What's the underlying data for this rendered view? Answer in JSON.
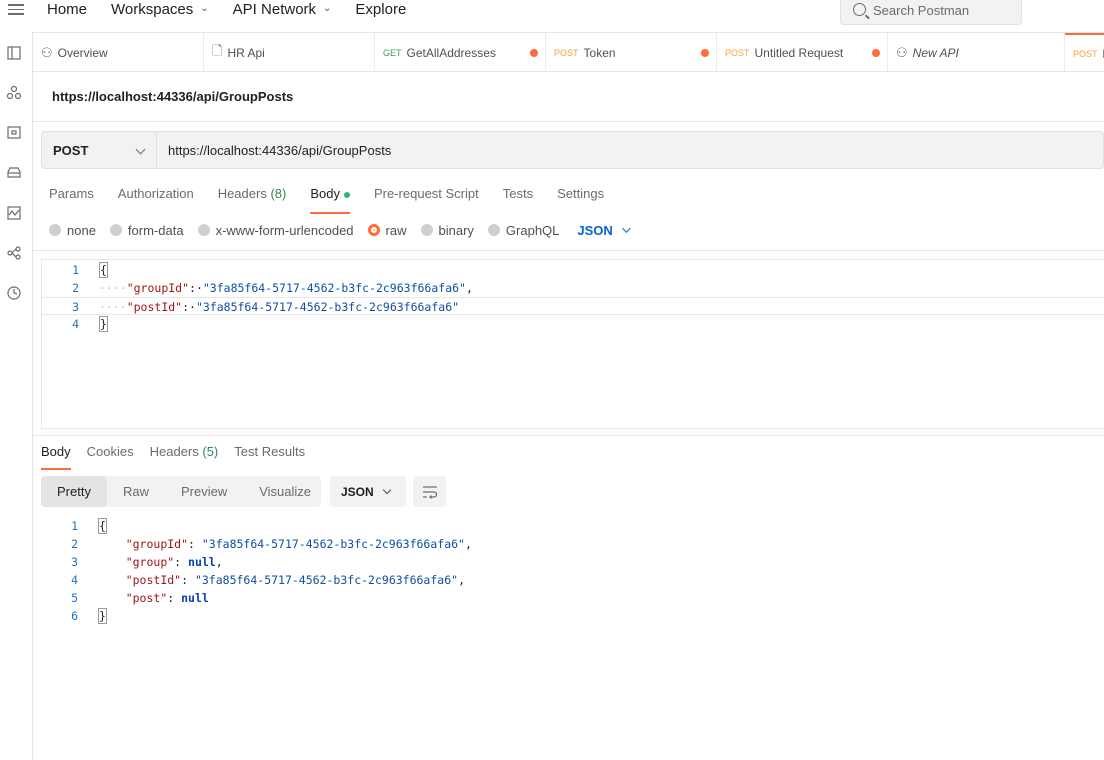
{
  "topnav": {
    "items": [
      {
        "label": "Home"
      },
      {
        "label": "Workspaces"
      },
      {
        "label": "API Network"
      },
      {
        "label": "Explore"
      }
    ],
    "search_placeholder": "Search Postman"
  },
  "tabs": [
    {
      "label": "Overview"
    },
    {
      "label": "HR Api"
    },
    {
      "method": "GET",
      "label": "GetAllAddresses"
    },
    {
      "method": "POST",
      "label": "Token"
    },
    {
      "method": "POST",
      "label": "Untitled Request"
    },
    {
      "label": "New API"
    },
    {
      "method": "POST",
      "label": "h"
    }
  ],
  "request": {
    "title": "https://localhost:44336/api/GroupPosts",
    "method": "POST",
    "url": "https://localhost:44336/api/GroupPosts",
    "tabs": {
      "params": "Params",
      "authorization": "Authorization",
      "headers": "Headers",
      "headers_count": "(8)",
      "body": "Body",
      "prerequest": "Pre-request Script",
      "tests": "Tests",
      "settings": "Settings"
    },
    "body_types": {
      "none": "none",
      "form_data": "form-data",
      "urlencoded": "x-www-form-urlencoded",
      "raw": "raw",
      "binary": "binary",
      "graphql": "GraphQL",
      "format": "JSON"
    },
    "body_lines": {
      "n1": "1",
      "n2": "2",
      "n3": "3",
      "n4": "4",
      "open": "{",
      "k_group_id": "\"groupId\"",
      "v_group_id": "\"3fa85f64-5717-4562-b3fc-2c963f66afa6\"",
      "k_post_id": "\"postId\"",
      "v_post_id": "\"3fa85f64-5717-4562-b3fc-2c963f66afa6\"",
      "close": "}"
    }
  },
  "response": {
    "tabs": {
      "body": "Body",
      "cookies": "Cookies",
      "headers": "Headers",
      "headers_count": "(5)",
      "test_results": "Test Results"
    },
    "view_modes": {
      "pretty": "Pretty",
      "raw": "Raw",
      "preview": "Preview",
      "visualize": "Visualize"
    },
    "format": "JSON",
    "lines": {
      "n1": "1",
      "n2": "2",
      "n3": "3",
      "n4": "4",
      "n5": "5",
      "n6": "6",
      "open": "{",
      "k_group_id": "\"groupId\"",
      "v_group_id": "\"3fa85f64-5717-4562-b3fc-2c963f66afa6\"",
      "k_group": "\"group\"",
      "v_group": "null",
      "k_post_id": "\"postId\"",
      "v_post_id": "\"3fa85f64-5717-4562-b3fc-2c963f66afa6\"",
      "k_post": "\"post\"",
      "v_post": "null",
      "close": "}"
    }
  },
  "colors": {
    "accent": "#ff6c37",
    "get_method": "#3a9e53",
    "post_method": "#f4a33c",
    "json_link": "#0265d2"
  }
}
